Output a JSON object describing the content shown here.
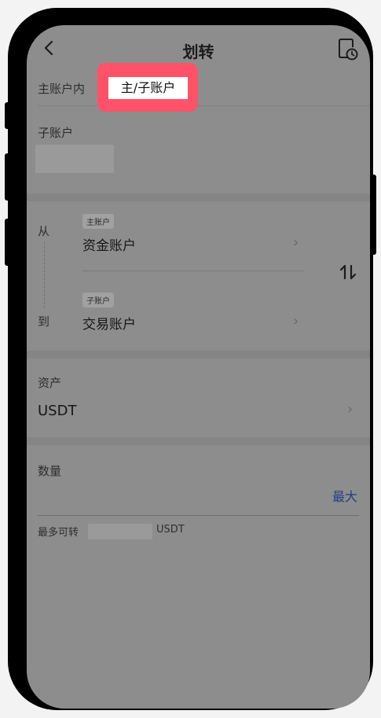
{
  "header": {
    "title": "划转",
    "back_icon": "chevron-left-icon",
    "history_icon": "clock-document-icon"
  },
  "tabs": {
    "inner": "主账户内",
    "sub": "主/子账户",
    "highlight_color": "#fe5268"
  },
  "sub_account": {
    "label": "子账户"
  },
  "transfer": {
    "from_label": "从",
    "to_label": "到",
    "from": {
      "tag": "主账户",
      "account": "资金账户"
    },
    "to": {
      "tag": "子账户",
      "account": "交易账户"
    },
    "swap_icon": "swap-vertical-icon",
    "chevron": "›"
  },
  "asset": {
    "label": "资产",
    "value": "USDT",
    "chevron": "›"
  },
  "quantity": {
    "label": "数量",
    "max_label": "最大",
    "max_color": "#1f3f8a"
  },
  "available": {
    "label": "最多可转",
    "unit": "USDT"
  }
}
